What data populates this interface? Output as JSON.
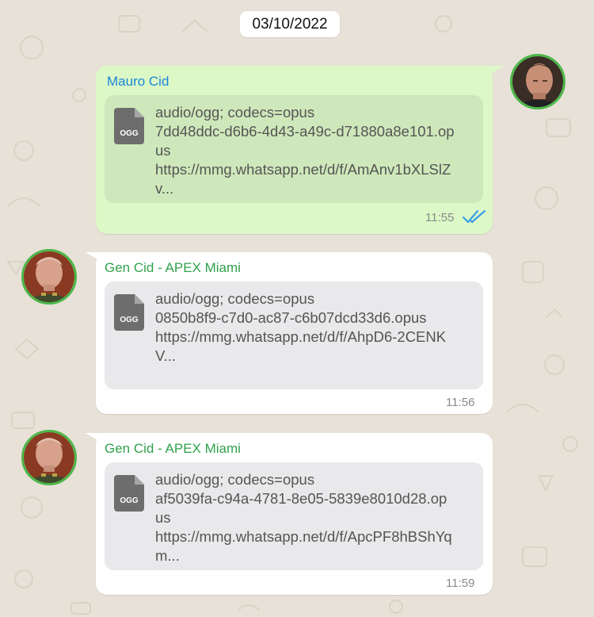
{
  "date": "03/10/2022",
  "colors": {
    "outgoing_bubble": "#dcf8c6",
    "incoming_bubble": "#ffffff",
    "sender_outgoing": "#1a86d8",
    "sender_incoming": "#31a24c",
    "read_ticks": "#3a9ee8",
    "avatar_ring": "#4cb748"
  },
  "messages": [
    {
      "direction": "outgoing",
      "sender": "Mauro Cid",
      "attachment": {
        "icon": "file-icon",
        "badge": "OGG",
        "lines": [
          "audio/ogg; codecs=opus",
          "7dd48ddc-d6b6-4d43-a49c-d71880a8e101.op",
          "us",
          "https://mmg.whatsapp.net/d/f/AmAnv1bXLSlZ",
          "v..."
        ]
      },
      "time": "11:55",
      "status": "read"
    },
    {
      "direction": "incoming",
      "sender": "Gen Cid - APEX Miami",
      "attachment": {
        "icon": "file-icon",
        "badge": "OGG",
        "lines": [
          "audio/ogg; codecs=opus",
          "0850b8f9-c7d0-ac87-c6b07dcd33d6.opus",
          "https://mmg.whatsapp.net/d/f/AhpD6-2CENK",
          "V..."
        ]
      },
      "time": "11:56"
    },
    {
      "direction": "incoming",
      "sender": "Gen Cid - APEX Miami",
      "attachment": {
        "icon": "file-icon",
        "badge": "OGG",
        "lines": [
          "audio/ogg; codecs=opus",
          "af5039fa-c94a-4781-8e05-5839e8010d28.op",
          "us",
          "https://mmg.whatsapp.net/d/f/ApcPF8hBShYq",
          "m..."
        ]
      },
      "time": "11:59"
    }
  ]
}
